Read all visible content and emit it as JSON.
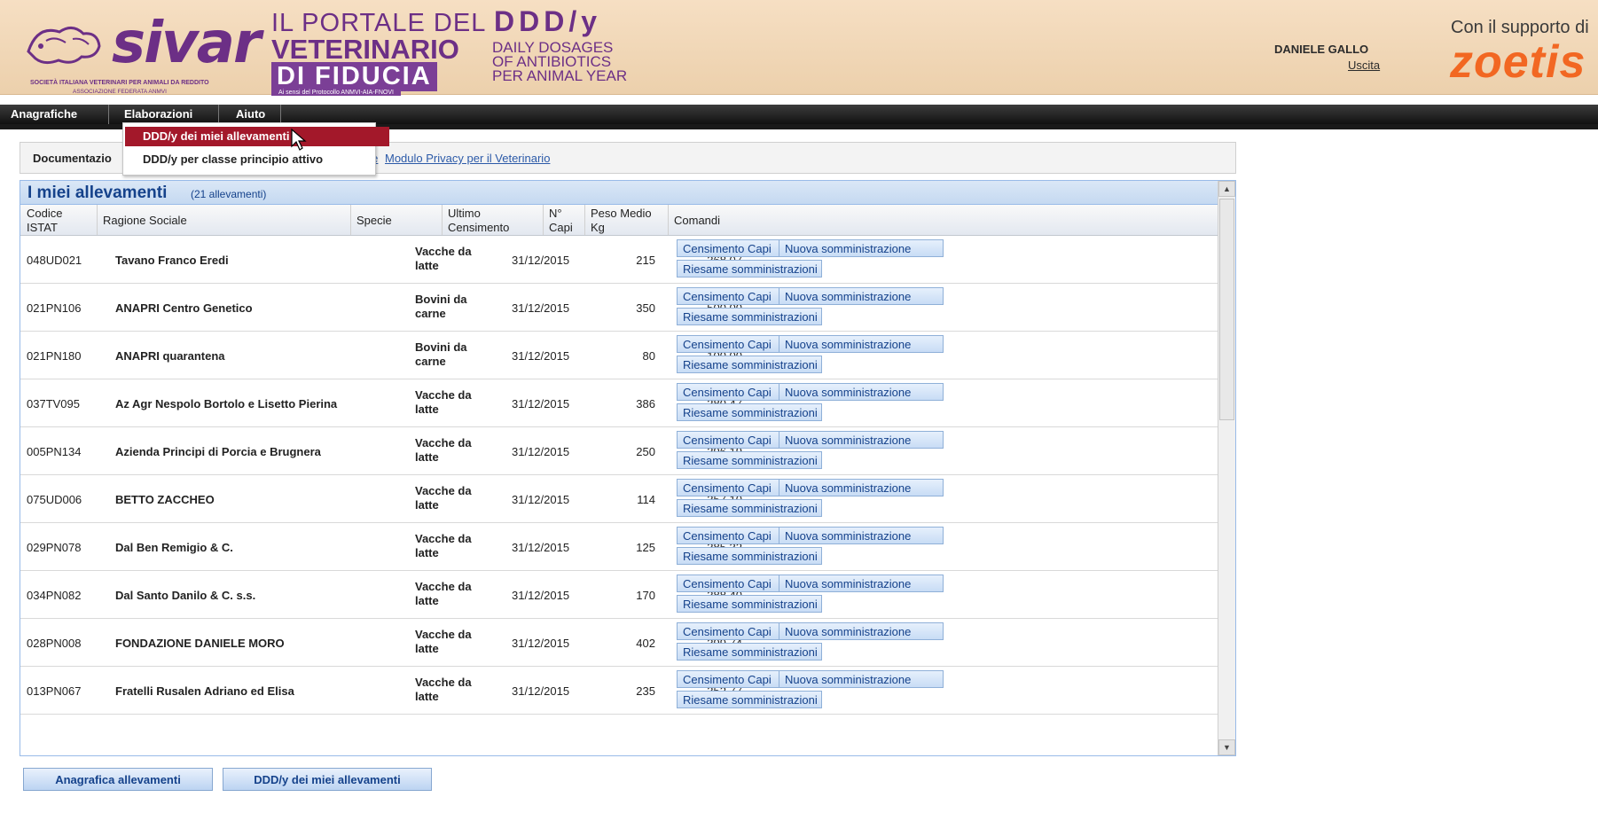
{
  "header": {
    "sivar_logo": "sivar",
    "sivar_subtitle": "SOCIETÀ ITALIANA VETERINARI PER ANIMALI DA REDDITO",
    "sivar_federation": "ASSOCIAZIONE FEDERATA ANMVI",
    "portale_line1": "IL PORTALE DEL",
    "portale_line2": "VETERINARIO",
    "portale_line3": "DI FIDUCIA",
    "portale_line4": "Ai sensi del Protocollo ANMVI-AIA-FNOVI",
    "ddd_title": "DDD/y",
    "ddd_line1": "DAILY DOSAGES",
    "ddd_line2": "OF ANTIBIOTICS",
    "ddd_line3": "PER ANIMAL YEAR",
    "user_name": "DANIELE GALLO",
    "logout": "Uscita",
    "support_text": "Con il supporto di",
    "sponsor": "zoetis"
  },
  "menu": {
    "items": [
      "Anagrafiche",
      "Elaborazioni",
      "Aiuto"
    ],
    "dropdown": [
      "DDD/y dei miei allevamenti",
      "DDD/y per classe principio attivo"
    ]
  },
  "links": {
    "doc_label": "Documentazio",
    "link1": "evatore",
    "link2": "Modulo Privacy per il Veterinario"
  },
  "panel": {
    "title": "I miei allevamenti",
    "count": "(21 allevamenti)",
    "columns": {
      "code_l1": "Codice",
      "code_l2": "ISTAT",
      "name": "Ragione Sociale",
      "species": "Specie",
      "census_l1": "Ultimo",
      "census_l2": "Censimento",
      "heads_l1": "N°",
      "heads_l2": "Capi",
      "weight_l1": "Peso Medio",
      "weight_l2": "Kg",
      "commands": "Comandi"
    },
    "buttons": {
      "census": "Censimento Capi",
      "new_admin": "Nuova somministrazione",
      "review": "Riesame somministrazioni"
    },
    "rows": [
      {
        "code": "048UD021",
        "name": "Tavano Franco Eredi",
        "species_l1": "Vacche da",
        "species_l2": "latte",
        "date": "31/12/2015",
        "heads": "215",
        "weight": "368,07"
      },
      {
        "code": "021PN106",
        "name": "ANAPRI Centro Genetico",
        "species_l1": "Bovini da",
        "species_l2": "carne",
        "date": "31/12/2015",
        "heads": "350",
        "weight": "500,00"
      },
      {
        "code": "021PN180",
        "name": "ANAPRI quarantena",
        "species_l1": "Bovini da",
        "species_l2": "carne",
        "date": "31/12/2015",
        "heads": "80",
        "weight": "100,00"
      },
      {
        "code": "037TV095",
        "name": "Az Agr Nespolo Bortolo e Lisetto Pierina",
        "species_l1": "Vacche da",
        "species_l2": "latte",
        "date": "31/12/2015",
        "heads": "386",
        "weight": "380,47"
      },
      {
        "code": "005PN134",
        "name": "Azienda Principi di Porcia e Brugnera",
        "species_l1": "Vacche da",
        "species_l2": "latte",
        "date": "31/12/2015",
        "heads": "250",
        "weight": "396,19"
      },
      {
        "code": "075UD006",
        "name": "BETTO ZACCHEO",
        "species_l1": "Vacche da",
        "species_l2": "latte",
        "date": "31/12/2015",
        "heads": "114",
        "weight": "357,10"
      },
      {
        "code": "029PN078",
        "name": "Dal Ben Remigio & C.",
        "species_l1": "Vacche da",
        "species_l2": "latte",
        "date": "31/12/2015",
        "heads": "125",
        "weight": "385,32"
      },
      {
        "code": "034PN082",
        "name": "Dal Santo Danilo & C. s.s.",
        "species_l1": "Vacche da",
        "species_l2": "latte",
        "date": "31/12/2015",
        "heads": "170",
        "weight": "388,40"
      },
      {
        "code": "028PN008",
        "name": "FONDAZIONE DANIELE MORO",
        "species_l1": "Vacche da",
        "species_l2": "latte",
        "date": "31/12/2015",
        "heads": "402",
        "weight": "399,74"
      },
      {
        "code": "013PN067",
        "name": "Fratelli Rusalen Adriano ed Elisa",
        "species_l1": "Vacche da",
        "species_l2": "latte",
        "date": "31/12/2015",
        "heads": "235",
        "weight": "352,77"
      }
    ]
  },
  "bottom": {
    "btn1": "Anagrafica allevamenti",
    "btn2": "DDD/y dei miei allevamenti"
  },
  "colors": {
    "brand_purple": "#6c2f86",
    "menu_active": "#a3182a",
    "grid_header": "#15428b",
    "zoetis_orange": "#f26722"
  }
}
